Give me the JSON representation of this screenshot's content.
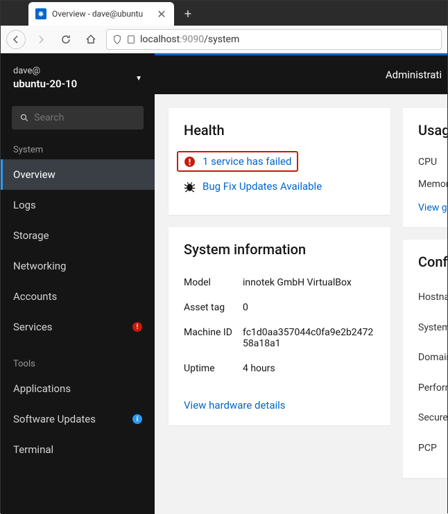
{
  "browser": {
    "tab_title": "Overview - dave@ubuntu",
    "url_host": "localhost",
    "url_port": ":9090",
    "url_path": "/system"
  },
  "sidebar": {
    "host_user": "dave@",
    "host_name": "ubuntu-20-10",
    "search_placeholder": "Search",
    "section_system": "System",
    "section_tools": "Tools",
    "items_system": [
      {
        "label": "Overview",
        "active": true
      },
      {
        "label": "Logs"
      },
      {
        "label": "Storage"
      },
      {
        "label": "Networking"
      },
      {
        "label": "Accounts"
      },
      {
        "label": "Services",
        "badge": "error"
      }
    ],
    "items_tools": [
      {
        "label": "Applications"
      },
      {
        "label": "Software Updates",
        "badge": "info"
      },
      {
        "label": "Terminal"
      }
    ]
  },
  "topbar": {
    "admin_label": "Administrati"
  },
  "health": {
    "title": "Health",
    "failed": "1 service has failed",
    "bugfix": "Bug Fix Updates Available"
  },
  "sysinfo": {
    "title": "System information",
    "rows": [
      {
        "label": "Model",
        "value": "innotek GmbH VirtualBox"
      },
      {
        "label": "Asset tag",
        "value": "0"
      },
      {
        "label": "Machine ID",
        "value": "fc1d0aa357044c0fa9e2b247258a18a1"
      },
      {
        "label": "Uptime",
        "value": "4 hours"
      }
    ],
    "hw_link": "View hardware details"
  },
  "usage": {
    "title": "Usage",
    "items": [
      "CPU",
      "Memory"
    ],
    "view_link": "View gr"
  },
  "config": {
    "title": "Confi",
    "items": [
      "Hostnam",
      "System",
      "Domain",
      "Perform profile",
      "Secure S",
      "PCP"
    ]
  }
}
